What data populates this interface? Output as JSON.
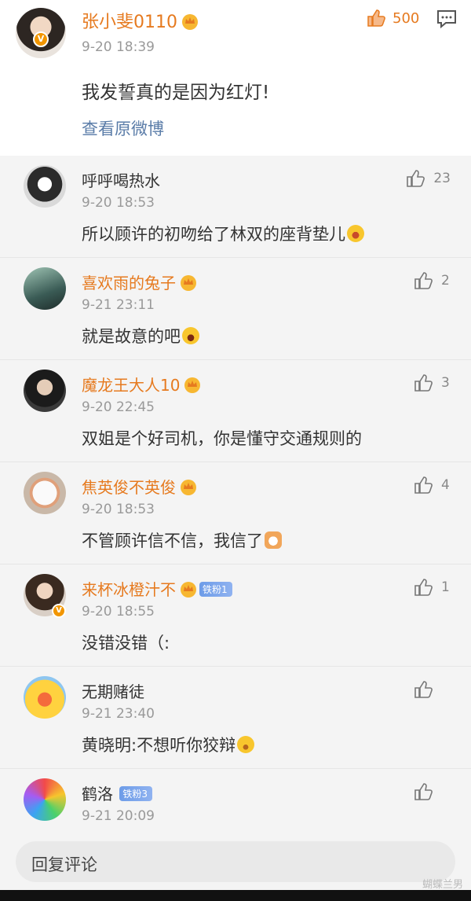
{
  "original_post": {
    "user_name": "张小斐0110",
    "timestamp": "9-20 18:39",
    "like_count": "500",
    "content": "我发誓真的是因为红灯!",
    "view_original_link": "查看原微博"
  },
  "replies": [
    {
      "name": "呼呼喝热水",
      "date": "9-20 18:53",
      "text": "所以顾许的初吻给了林双的座背垫儿",
      "likes": "23",
      "gold": false
    },
    {
      "name": "喜欢雨的兔子",
      "date": "9-21 23:11",
      "text": "就是故意的吧",
      "likes": "2",
      "gold": true
    },
    {
      "name": "魔龙王大人10",
      "date": "9-20 22:45",
      "text": "双姐是个好司机，你是懂守交通规则的",
      "likes": "3",
      "gold": true
    },
    {
      "name": "焦英俊不英俊",
      "date": "9-20 18:53",
      "text": "不管顾许信不信，我信了",
      "likes": "4",
      "gold": true
    },
    {
      "name": "来杯冰橙汁不",
      "date": "9-20 18:55",
      "text": "没错没错（:",
      "likes": "1",
      "gold": true,
      "fan_badge": "铁粉1"
    },
    {
      "name": "无期赌徒",
      "date": "9-21 23:40",
      "text": "黄晓明:不想听你狡辩",
      "likes": "",
      "gold": false
    },
    {
      "name": "鹤洛",
      "date": "9-21 20:09",
      "text": "",
      "likes": "",
      "gold": false,
      "fan_badge": "铁粉3"
    }
  ],
  "reply_input": {
    "placeholder": "回复评论"
  },
  "watermark": "蝴蝶兰男",
  "colors": {
    "gold_name": "#e67a1f",
    "link": "#5a7ca8",
    "fan_badge": "#6d9ce8"
  }
}
